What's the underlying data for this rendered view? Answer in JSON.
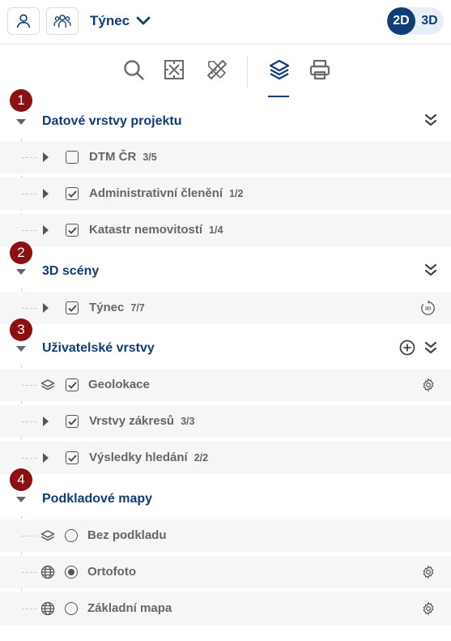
{
  "header": {
    "project_name": "Týnec",
    "mode_2d": "2D",
    "mode_3d": "3D",
    "active_mode": "2D"
  },
  "icons": {
    "user": "user-icon",
    "group": "group-icon",
    "dropdown": "chevron-down-icon",
    "search": "search-icon",
    "measure": "measure-area-icon",
    "draw": "ruler-pencil-icon",
    "layers": "layers-icon",
    "print": "print-icon"
  },
  "colors": {
    "brand": "#0f3d75",
    "badge": "#8c0f12",
    "row_bg": "#f6f6f6"
  },
  "sections": [
    {
      "badge": "1",
      "title": "Datové vrstvy projektu",
      "rows": [
        {
          "label": "DTM ČR",
          "count": "3/5",
          "checked": false
        },
        {
          "label": "Administrativní členění",
          "count": "1/2",
          "checked": true
        },
        {
          "label": "Katastr nemovitostí",
          "count": "1/4",
          "checked": true
        }
      ]
    },
    {
      "badge": "2",
      "title": "3D scény",
      "rows": [
        {
          "label": "Týnec",
          "count": "7/7",
          "checked": true,
          "right_icon": "3D"
        }
      ]
    },
    {
      "badge": "3",
      "title": "Uživatelské vrstvy",
      "rows": [
        {
          "label": "Geolokace",
          "checked": true
        },
        {
          "label": "Vrstvy zákresů",
          "count": "3/3",
          "checked": true
        },
        {
          "label": "Výsledky hledání",
          "count": "2/2",
          "checked": true
        }
      ]
    },
    {
      "badge": "4",
      "title": "Podkladové mapy",
      "rows": [
        {
          "label": "Bez podkladu",
          "selected": false
        },
        {
          "label": "Ortofoto",
          "selected": true
        },
        {
          "label": "Základní mapa",
          "selected": false
        }
      ]
    }
  ]
}
